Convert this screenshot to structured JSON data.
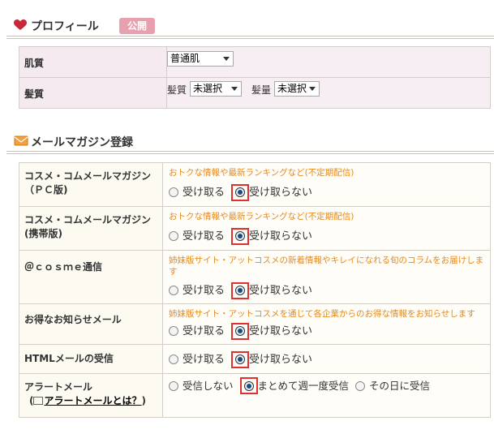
{
  "profile": {
    "title": "プロフィール",
    "badge": "公開",
    "skin_label": "肌質",
    "skin_value": "普通肌",
    "hair_label": "髪質",
    "hair_quality_label": "髪質",
    "hair_quality_value": "未選択",
    "hair_volume_label": "髪量",
    "hair_volume_value": "未選択"
  },
  "mail": {
    "title": "メールマガジン登録",
    "receive": "受け取る",
    "not_receive": "受け取らない",
    "rows": [
      {
        "label_1": "コスメ・コムメールマガジン",
        "label_2": "（ＰＣ版)",
        "note": "おトクな情報や最新ランキングなど(不定期配信)"
      },
      {
        "label_1": "コスメ・コムメールマガジン",
        "label_2": "(携帯版)",
        "note": "おトクな情報や最新ランキングなど(不定期配信)"
      },
      {
        "label_1": "＠ｃｏｓｍｅ通信",
        "note_1": "姉妹版サイト・アットコスメの新着情報やキレイになれる旬のコラムをお届けしま",
        "note_2": "す"
      },
      {
        "label_1": "お得なお知らせメール",
        "note": "姉妹版サイト・アットコスメを通じて各企業からのお得な情報をお知らせします"
      },
      {
        "label_1": "HTMLメールの受信"
      }
    ],
    "alert": {
      "label": "アラートメール",
      "link_prefix": "(",
      "link": "アラートメールとは？",
      "link_suffix": ")",
      "opt_none": "受信しない",
      "opt_weekly": "まとめて週一度受信",
      "opt_daily": "その日に受信"
    }
  }
}
